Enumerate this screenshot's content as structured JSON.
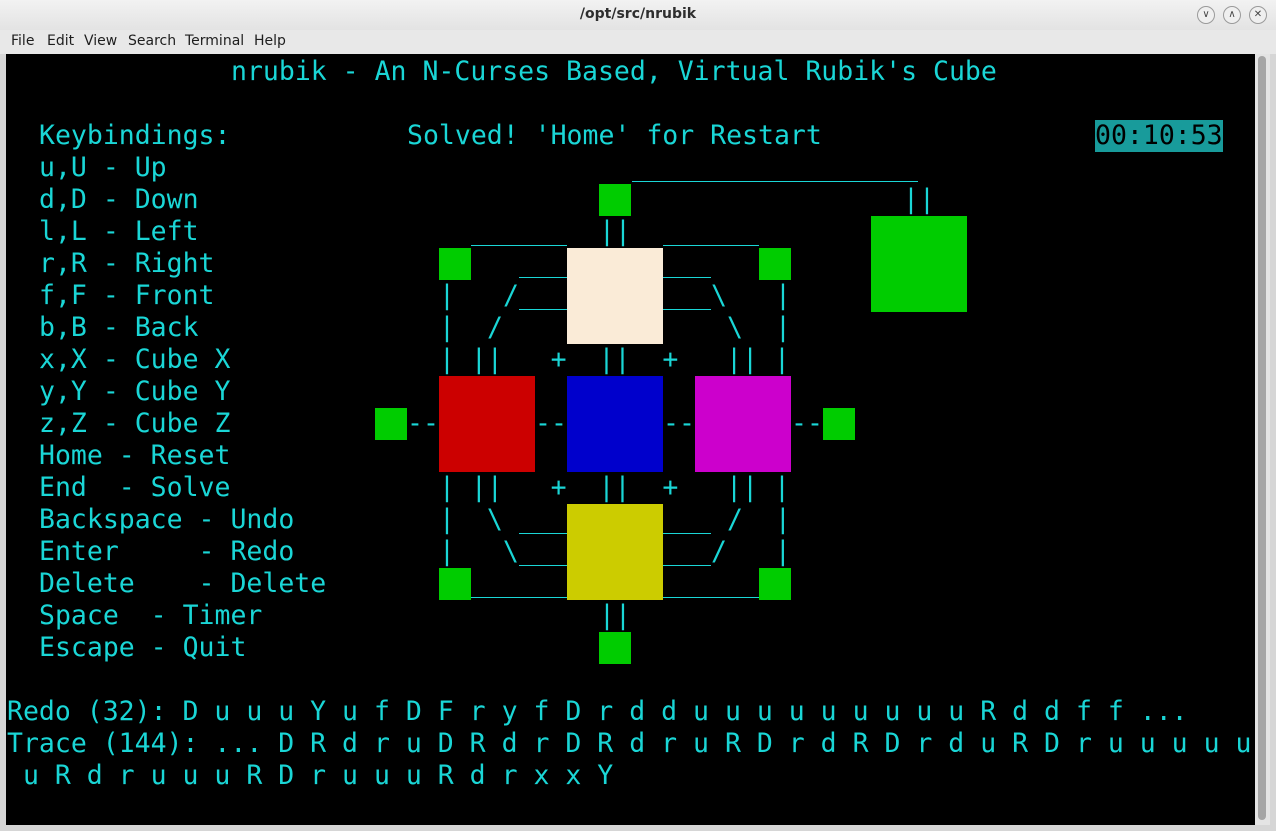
{
  "window": {
    "title": "/opt/src/nrubik",
    "controls": [
      "∨",
      "∧",
      "✕"
    ]
  },
  "menu": [
    "File",
    "Edit",
    "View",
    "Search",
    "Terminal",
    "Help"
  ],
  "app": {
    "heading": "nrubik - An N-Curses Based, Virtual Rubik's Cube",
    "status": "Solved! 'Home' for Restart",
    "timer": "00:10:53"
  },
  "keybindings": {
    "title": "Keybindings:",
    "items": [
      "u,U - Up",
      "d,D - Down",
      "l,L - Left",
      "r,R - Right",
      "f,F - Front",
      "b,B - Back",
      "x,X - Cube X",
      "y,Y - Cube Y",
      "z,Z - Cube Z",
      "Home - Reset",
      "End  - Solve",
      "Backspace - Undo",
      "Enter     - Redo",
      "Delete    - Delete",
      "Space  - Timer",
      "Escape - Quit"
    ]
  },
  "cube_art": {
    "row_upper": [
      "|",
      "/",
      "\\",
      "|",
      "|",
      "/",
      "\\",
      "|",
      "| ||   +  ||  +   || |"
    ],
    "row_lower": [
      "| ||   +  ||  +   || |",
      "|  \\",
      "/  |",
      "|   \\",
      "/   |"
    ],
    "mid_left": "--",
    "mid_a": "--",
    "mid_b": "--",
    "mid_right": "--",
    "top_link": "||",
    "bottom_link": "||",
    "back_link": "||"
  },
  "faces": {
    "up": "#faebd7",
    "left": "#cc0000",
    "front": "#0000cc",
    "right": "#cc00cc",
    "down": "#cccc00",
    "back": "#00cc00",
    "edge": "#00cc00"
  },
  "redo_line": "Redo (32): D u u u Y u f D F r y f D r d d u u u u u u u u u R d d f f ...",
  "trace_line1": "Trace (144): ... D R d r u D R d r D R d r u R D r d R D r d u R D r u u u u u",
  "trace_line2": " u R d r u u u R D r u u u R d r x x Y"
}
